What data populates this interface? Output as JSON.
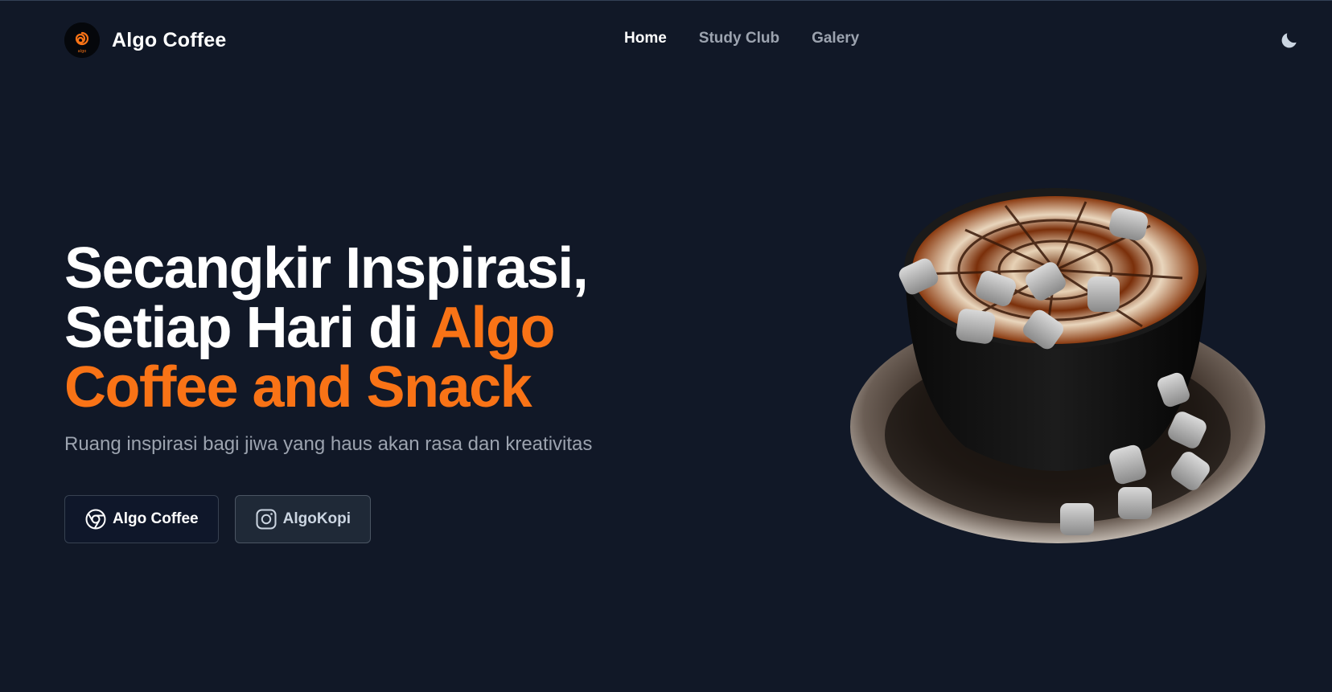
{
  "header": {
    "brand_name": "Algo Coffee",
    "logo_text": "algo",
    "nav": [
      {
        "label": "Home",
        "active": true
      },
      {
        "label": "Study Club",
        "active": false
      },
      {
        "label": "Galery",
        "active": false
      }
    ],
    "theme_icon": "moon-icon"
  },
  "hero": {
    "title_part1": "Secangkir Inspirasi,",
    "title_part2": "Setiap Hari di ",
    "title_accent1": "Algo",
    "title_accent2": "Coffee and Snack",
    "subtitle": "Ruang inspirasi bagi jiwa yang haus akan rasa dan kreativitas",
    "buttons": [
      {
        "label": "Algo Coffee",
        "icon": "chrome-icon"
      },
      {
        "label": "AlgoKopi",
        "icon": "instagram-icon"
      }
    ]
  },
  "colors": {
    "background": "#111827",
    "accent": "#f97316",
    "text": "#ffffff",
    "muted": "#9ca3af"
  }
}
